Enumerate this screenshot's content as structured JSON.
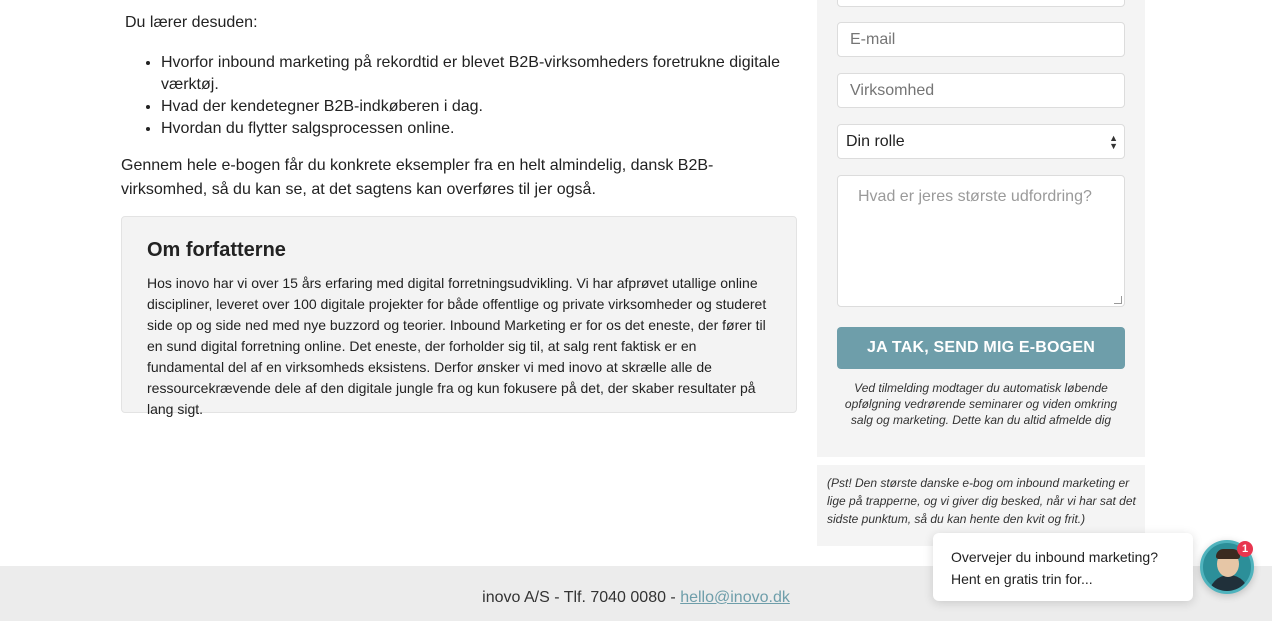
{
  "content": {
    "intro": "Du lærer desuden:",
    "bullets": [
      "Hvorfor inbound marketing på rekordtid er blevet B2B-virksomheders foretrukne digitale værktøj.",
      "Hvad der kendetegner B2B-indkøberen i dag.",
      "Hvordan du flytter salgsprocessen online."
    ],
    "paragraph": "Gennem hele e-bogen får du konkrete eksempler fra en helt almindelig, dansk B2B-virksomhed, så du kan se, at det sagtens kan overføres til jer også.",
    "about": {
      "title": "Om forfatterne",
      "text": "Hos inovo har vi over 15 års erfaring med digital forretningsudvikling. Vi har afprøvet utallige online discipliner, leveret over 100 digitale projekter for både offentlige og private virksomheder og studeret side op og side ned med nye buzzord og teorier. Inbound Marketing er for os det eneste, der fører til en sund digital forretning online. Det eneste, der forholder sig til, at salg rent faktisk er en fundamental del af en virksomheds eksistens. Derfor ønsker vi med inovo at skrælle alle de ressourcekrævende dele af den digitale jungle fra og kun fokusere på det, der skaber resultater på lang sigt."
    }
  },
  "form": {
    "email_placeholder": "E-mail",
    "company_placeholder": "Virksomhed",
    "role_selected": "Din rolle",
    "challenge_placeholder": "Hvad er jeres største udfordring?",
    "submit_label": "JA TAK, SEND MIG E-BOGEN",
    "consent": "Ved tilmelding modtager du automatisk løbende opfølgning vedrørende seminarer og viden omkring salg og marketing. Dette kan du altid afmelde dig",
    "pst": "(Pst! Den største danske e-bog om inbound marketing er lige på trapperne, og vi giver dig besked, når vi har sat det sidste punktum, så du kan hente den kvit og frit.)"
  },
  "footer": {
    "text": "inovo A/S - Tlf. 7040 0080 - ",
    "email": "hello@inovo.dk"
  },
  "chat": {
    "line1": "Overvejer du inbound marketing?",
    "line2": "Hent en gratis trin for...",
    "badge": "1"
  },
  "colors": {
    "accent": "#6e9eaa",
    "badge": "#e8364f"
  }
}
